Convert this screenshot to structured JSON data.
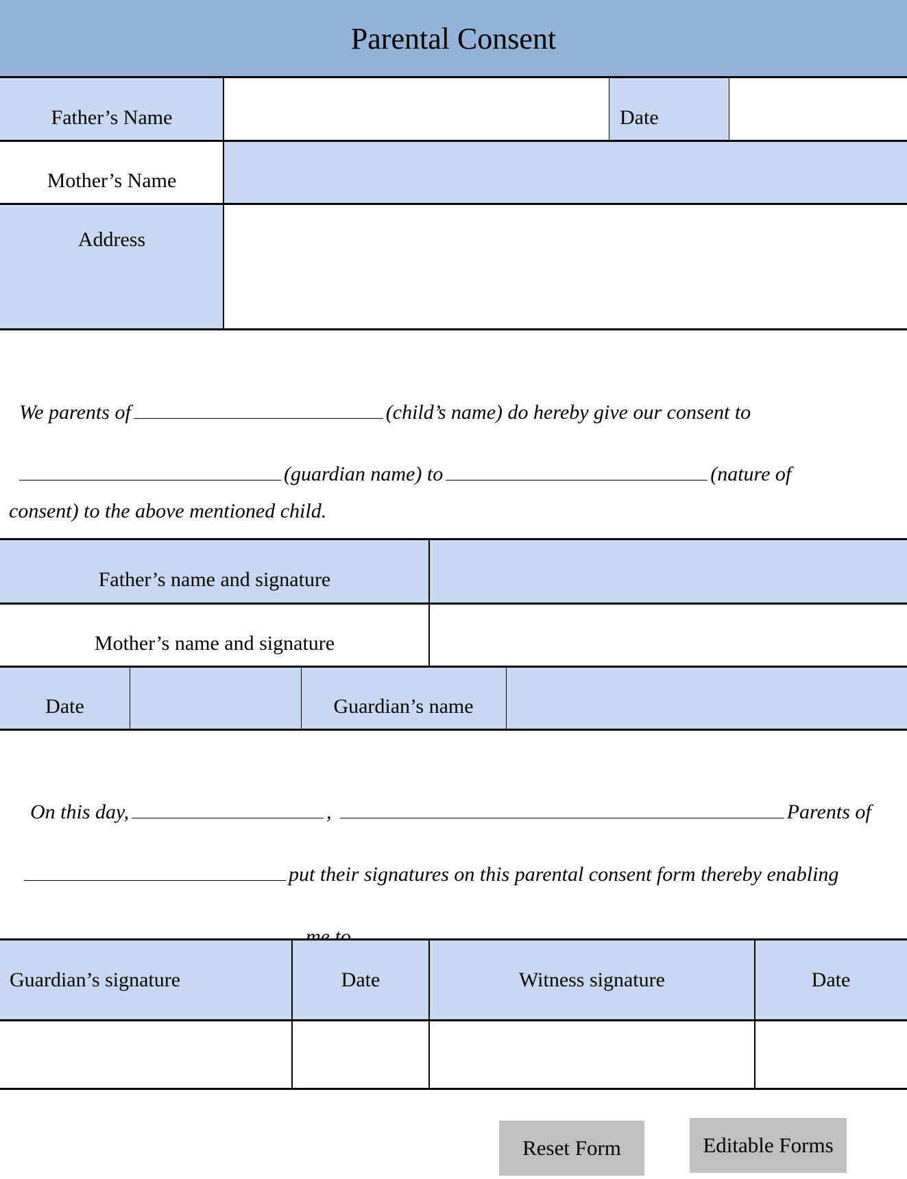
{
  "title": "Parental Consent",
  "section1": {
    "fathers_name_label": "Father’s Name",
    "fathers_name_value": "",
    "date_label": "Date",
    "date_value": "",
    "mothers_name_label": "Mother’s Name",
    "mothers_name_value": "",
    "address_label": "Address",
    "address_value": ""
  },
  "consent_paragraph": {
    "line1_start": "We parents of",
    "line1_end": "(child’s name) do hereby give our consent to",
    "line2_mid": "(guardian name) to",
    "line2_end": "(nature of",
    "line3": "consent) to the above mentioned child."
  },
  "section2": {
    "father_sig_label": "Father’s name and signature",
    "mother_sig_label": "Mother’s name and signature",
    "date_label": "Date",
    "guardian_name_label": "Guardian’s name"
  },
  "statement_paragraph": {
    "line1_start": "On this day,",
    "line1_comma": ",",
    "line1_end": "Parents of",
    "line2_end": "put their signatures on this parental consent form thereby enabling",
    "line3_start": "me to",
    "line3_end": "."
  },
  "section3": {
    "headers": [
      "Guardian’s signature",
      "Date",
      "Witness signature",
      "Date"
    ]
  },
  "buttons": {
    "reset": "Reset Form",
    "editable": "Editable Forms"
  },
  "colors": {
    "header_bg": "#95b3d7",
    "cell_bg": "#c6d9f1",
    "button_bg": "#c0c0c0"
  }
}
